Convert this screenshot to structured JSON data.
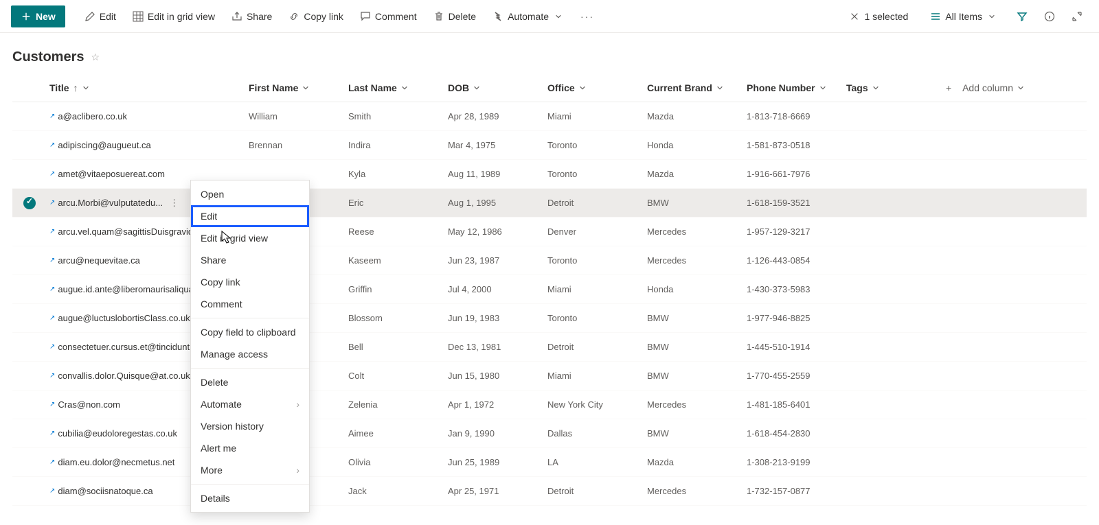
{
  "toolbar": {
    "new": "New",
    "edit": "Edit",
    "grid": "Edit in grid view",
    "share": "Share",
    "copylink": "Copy link",
    "comment": "Comment",
    "delete": "Delete",
    "automate": "Automate",
    "selected": "1 selected",
    "view": "All Items"
  },
  "page": {
    "title": "Customers"
  },
  "columns": {
    "title": "Title",
    "first": "First Name",
    "last": "Last Name",
    "dob": "DOB",
    "office": "Office",
    "brand": "Current Brand",
    "phone": "Phone Number",
    "tags": "Tags",
    "add": "Add column"
  },
  "rows": [
    {
      "t": "a@aclibero.co.uk",
      "f": "William",
      "l": "Smith",
      "d": "Apr 28, 1989",
      "o": "Miami",
      "b": "Mazda",
      "p": "1-813-718-6669",
      "sel": false
    },
    {
      "t": "adipiscing@augueut.ca",
      "f": "Brennan",
      "l": "Indira",
      "d": "Mar 4, 1975",
      "o": "Toronto",
      "b": "Honda",
      "p": "1-581-873-0518",
      "sel": false
    },
    {
      "t": "amet@vitaeposuereat.com",
      "f": "",
      "l": "Kyla",
      "d": "Aug 11, 1989",
      "o": "Toronto",
      "b": "Mazda",
      "p": "1-916-661-7976",
      "sel": false
    },
    {
      "t": "arcu.Morbi@vulputatedu...",
      "f": "",
      "l": "Eric",
      "d": "Aug 1, 1995",
      "o": "Detroit",
      "b": "BMW",
      "p": "1-618-159-3521",
      "sel": true
    },
    {
      "t": "arcu.vel.quam@sagittisDuisgravid",
      "f": "",
      "l": "Reese",
      "d": "May 12, 1986",
      "o": "Denver",
      "b": "Mercedes",
      "p": "1-957-129-3217",
      "sel": false
    },
    {
      "t": "arcu@nequevitae.ca",
      "f": "",
      "l": "Kaseem",
      "d": "Jun 23, 1987",
      "o": "Toronto",
      "b": "Mercedes",
      "p": "1-126-443-0854",
      "sel": false
    },
    {
      "t": "augue.id.ante@liberomaurisaliqua",
      "f": "",
      "l": "Griffin",
      "d": "Jul 4, 2000",
      "o": "Miami",
      "b": "Honda",
      "p": "1-430-373-5983",
      "sel": false
    },
    {
      "t": "augue@luctuslobortisClass.co.uk",
      "f": "",
      "l": "Blossom",
      "d": "Jun 19, 1983",
      "o": "Toronto",
      "b": "BMW",
      "p": "1-977-946-8825",
      "sel": false
    },
    {
      "t": "consectetuer.cursus.et@tinciduntl",
      "f": "",
      "l": "Bell",
      "d": "Dec 13, 1981",
      "o": "Detroit",
      "b": "BMW",
      "p": "1-445-510-1914",
      "sel": false
    },
    {
      "t": "convallis.dolor.Quisque@at.co.uk",
      "f": "",
      "l": "Colt",
      "d": "Jun 15, 1980",
      "o": "Miami",
      "b": "BMW",
      "p": "1-770-455-2559",
      "sel": false
    },
    {
      "t": "Cras@non.com",
      "f": "",
      "l": "Zelenia",
      "d": "Apr 1, 1972",
      "o": "New York City",
      "b": "Mercedes",
      "p": "1-481-185-6401",
      "sel": false
    },
    {
      "t": "cubilia@eudoloregestas.co.uk",
      "f": "",
      "l": "Aimee",
      "d": "Jan 9, 1990",
      "o": "Dallas",
      "b": "BMW",
      "p": "1-618-454-2830",
      "sel": false
    },
    {
      "t": "diam.eu.dolor@necmetus.net",
      "f": "",
      "l": "Olivia",
      "d": "Jun 25, 1989",
      "o": "LA",
      "b": "Mazda",
      "p": "1-308-213-9199",
      "sel": false
    },
    {
      "t": "diam@sociisnatoque.ca",
      "f": "",
      "l": "Jack",
      "d": "Apr 25, 1971",
      "o": "Detroit",
      "b": "Mercedes",
      "p": "1-732-157-0877",
      "sel": false
    }
  ],
  "menu": {
    "open": "Open",
    "edit": "Edit",
    "grid": "Edit in grid view",
    "share": "Share",
    "copylink": "Copy link",
    "comment": "Comment",
    "copyfield": "Copy field to clipboard",
    "manage": "Manage access",
    "delete": "Delete",
    "automate": "Automate",
    "version": "Version history",
    "alert": "Alert me",
    "more": "More",
    "details": "Details"
  }
}
